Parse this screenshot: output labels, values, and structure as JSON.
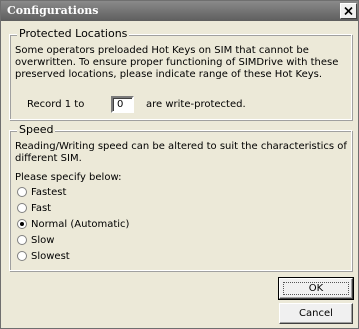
{
  "window": {
    "title": "Configurations"
  },
  "protected": {
    "legend": "Protected Locations",
    "description": "Some operators preloaded Hot Keys on SIM that cannot be overwritten.  To ensure proper functioning of SIMDrive with these preserved locations, please indicate range of these Hot Keys.",
    "record_label": "Record 1 to",
    "record_value": "0",
    "suffix": "are write-protected."
  },
  "speed": {
    "legend": "Speed",
    "description": "Reading/Writing speed can be altered to suit the characteristics of different SIM.",
    "prompt": "Please specify below:",
    "options": [
      {
        "label": "Fastest",
        "selected": false
      },
      {
        "label": "Fast",
        "selected": false
      },
      {
        "label": "Normal (Automatic)",
        "selected": true
      },
      {
        "label": "Slow",
        "selected": false
      },
      {
        "label": "Slowest",
        "selected": false
      }
    ]
  },
  "buttons": {
    "ok": "OK",
    "cancel": "Cancel"
  },
  "icons": {
    "close": "close-icon"
  }
}
